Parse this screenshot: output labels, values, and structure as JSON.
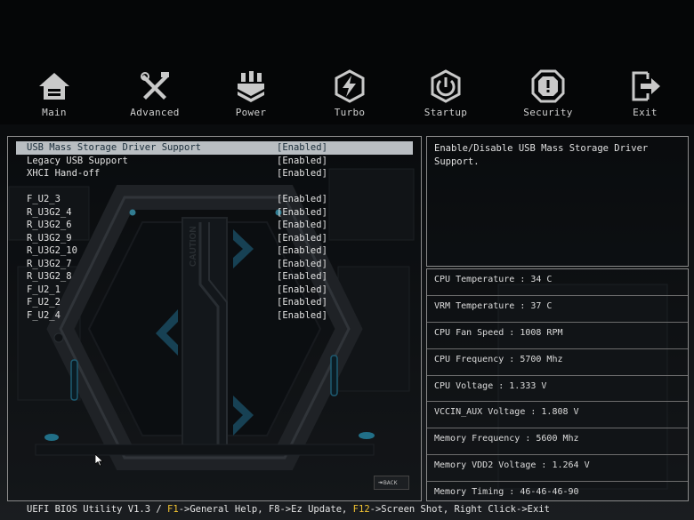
{
  "nav": [
    {
      "label": "Main",
      "icon": "home-icon"
    },
    {
      "label": "Advanced",
      "icon": "tools-icon"
    },
    {
      "label": "Power",
      "icon": "power-chip-icon"
    },
    {
      "label": "Turbo",
      "icon": "lightning-icon"
    },
    {
      "label": "Startup",
      "icon": "power-button-icon"
    },
    {
      "label": "Security",
      "icon": "shield-icon"
    },
    {
      "label": "Exit",
      "icon": "exit-icon"
    }
  ],
  "settings": [
    {
      "label": "USB Mass Storage Driver Support",
      "value": "[Enabled]",
      "selected": true
    },
    {
      "label": "Legacy USB Support",
      "value": "[Enabled]"
    },
    {
      "label": "XHCI Hand-off",
      "value": "[Enabled]"
    },
    {
      "label": "F_U2_3",
      "value": "[Enabled]"
    },
    {
      "label": "R_U3G2_4",
      "value": "[Enabled]"
    },
    {
      "label": "R_U3G2_6",
      "value": "[Enabled]"
    },
    {
      "label": "R_U3G2_9",
      "value": "[Enabled]"
    },
    {
      "label": "R_U3G2_10",
      "value": "[Enabled]"
    },
    {
      "label": "R_U3G2_7",
      "value": "[Enabled]"
    },
    {
      "label": "R_U3G2_8",
      "value": "[Enabled]"
    },
    {
      "label": "F_U2_1",
      "value": "[Enabled]"
    },
    {
      "label": "F_U2_2",
      "value": "[Enabled]"
    },
    {
      "label": "F_U2_4",
      "value": "[Enabled]"
    }
  ],
  "help": {
    "line1": "Enable/Disable USB Mass Storage Driver",
    "line2": "Support."
  },
  "hardware": [
    "CPU Temperature : 34 C",
    "VRM Temperature : 37 C",
    "CPU Fan Speed : 1008 RPM",
    "CPU Frequency : 5700 Mhz",
    "CPU Voltage : 1.333 V",
    "VCCIN_AUX Voltage : 1.808 V",
    "Memory Frequency : 5600 Mhz",
    "Memory VDD2 Voltage : 1.264 V",
    "Memory Timing : 46-46-46-90"
  ],
  "back_label": "BACK",
  "footer": {
    "prefix": "UEFI BIOS Utility V1.3 / ",
    "k1": "F1",
    "t1": "->General Help, F8->Ez Update, ",
    "k2": "F12",
    "t2": "->Screen Shot, Right Click->Exit"
  },
  "decor": {
    "caution_text": "CAUTION"
  },
  "colors": {
    "accent": "#2a86a8",
    "hotkey": "#f1c232",
    "selection": "#b9bec2"
  }
}
